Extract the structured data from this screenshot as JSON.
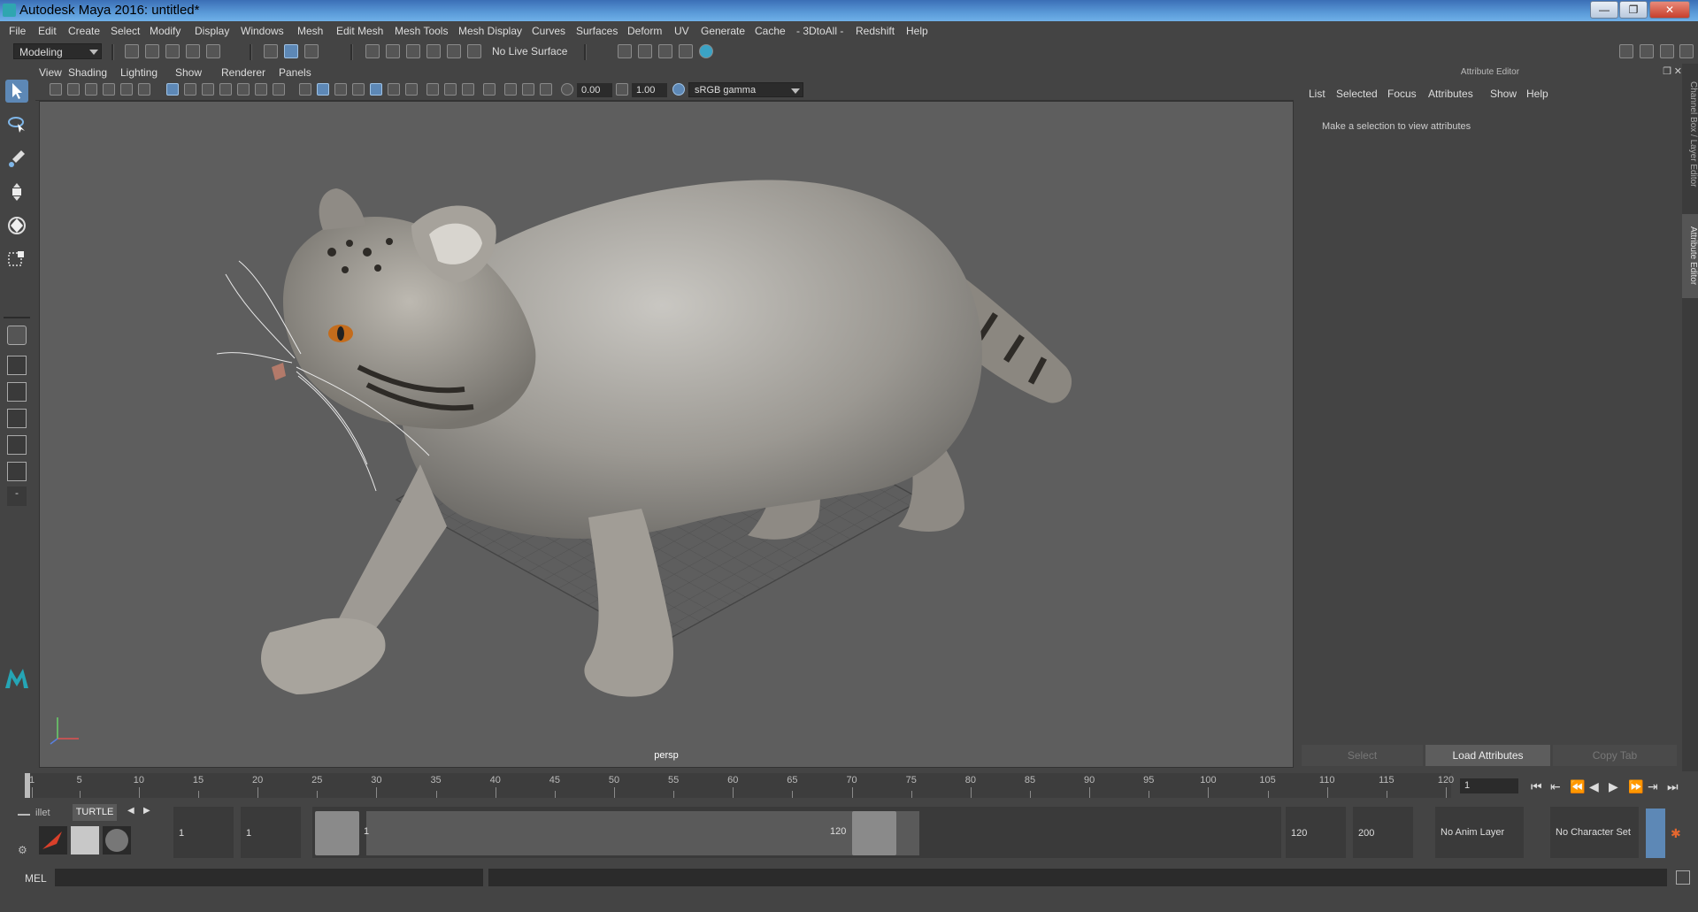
{
  "window": {
    "title": "Autodesk Maya 2016: untitled*",
    "min": "—",
    "max": "❐",
    "close": "✕"
  },
  "menubar": [
    "File",
    "Edit",
    "Create",
    "Select",
    "Modify",
    "Display",
    "Windows",
    "Mesh",
    "Edit Mesh",
    "Mesh Tools",
    "Mesh Display",
    "Curves",
    "Surfaces",
    "Deform",
    "UV",
    "Generate",
    "Cache",
    "- 3DtoAll -",
    "Redshift",
    "Help"
  ],
  "statusline": {
    "menuset": "Modeling",
    "live_surface": "No Live Surface"
  },
  "viewport": {
    "menus": [
      "View",
      "Shading",
      "Lighting",
      "Show",
      "Renderer",
      "Panels"
    ],
    "exposure": "0.00",
    "gamma": "1.00",
    "color_space": "sRGB gamma",
    "camera_label": "persp"
  },
  "attribute_editor": {
    "title": "Attribute Editor",
    "menus": [
      "List",
      "Selected",
      "Focus",
      "Attributes",
      "Show",
      "Help"
    ],
    "message": "Make a selection to view attributes",
    "buttons": {
      "select": "Select",
      "load": "Load Attributes",
      "copy": "Copy Tab"
    }
  },
  "side_tabs": {
    "channel_box": "Channel Box / Layer Editor",
    "attribute_editor": "Attribute Editor"
  },
  "timeline": {
    "ticks": [
      1,
      5,
      10,
      15,
      20,
      25,
      30,
      35,
      40,
      45,
      50,
      55,
      60,
      65,
      70,
      75,
      80,
      85,
      90,
      95,
      100,
      105,
      110,
      115,
      120
    ],
    "current_frame": "1"
  },
  "shelf": {
    "tab_partial": "illet",
    "tab_turtle": "TURTLE"
  },
  "range": {
    "start_field": "1",
    "start_field2": "1",
    "slider_start": "1",
    "slider_end": "120",
    "end_field": "120",
    "end_field2": "200",
    "anim_layer": "No Anim Layer",
    "character_set": "No Character Set"
  },
  "command_line": {
    "label": "MEL"
  },
  "colors": {
    "accent": "#5d88b6",
    "panel": "#444444",
    "viewport_bg": "#5e5e5e"
  }
}
